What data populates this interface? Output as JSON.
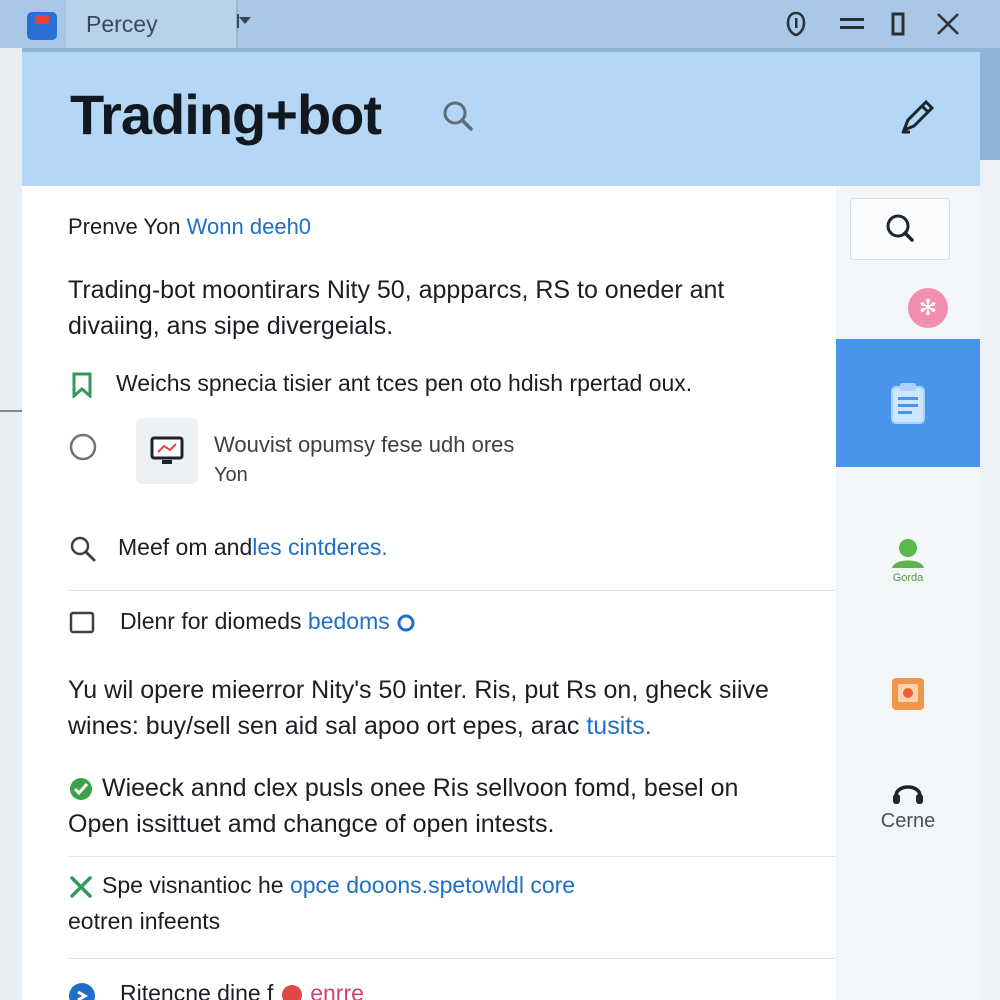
{
  "titlebar": {
    "tab_title": "Percey"
  },
  "header": {
    "app_title": "Trading+bot"
  },
  "content": {
    "intro_plain": "Prenve Yon ",
    "intro_link": "Wonn deeh0",
    "summary_line1": "Trading-bot moontirars Nity 50, appparcs, RS to oneder ant",
    "summary_line2": "divaiing, ans sipe divergeials.",
    "bookmark_item": "Weichs spnecia tisier ant tces pen oto hdish rpertad oux.",
    "card_line1": "Wouvist opumsy fese udh ores",
    "card_line2": "Yon",
    "search_plain": "Meef om and",
    "search_link": "les cintderes.",
    "box_plain": "Dlenr for diomeds ",
    "box_link": "bedoms",
    "para1_line1": "Yu wil opere mieerror Nity's 50 inter. Ris, put Rs on, gheck siive",
    "para1_line2_plain": "wines: buy/sell sen aid sal apoo ort epes, arac ",
    "para1_line2_link": "tusits.",
    "check_line1": "Wieeck annd clex pusls onee Ris sellvoon fomd, besel on",
    "check_line2": "Open issittuet amd changce of open intests.",
    "tools_plain": "Spe visnantioc he ",
    "tools_link": "opce dooons.spetowldl core",
    "tools_line2": "eotren infeents",
    "footer_plain": "Ritencne dine f",
    "footer_link": "enrre"
  },
  "rail": {
    "profile_label": "Gorda",
    "support_label": "Cerne"
  },
  "icons": {
    "app": "app-icon",
    "header_search": "search-icon",
    "header_edit": "edit-pen-icon",
    "bookmark": "bookmark-icon",
    "radio": "radio-circle-icon",
    "monitor": "monitor-icon",
    "search": "search-icon",
    "checkbox": "checkbox-icon",
    "check": "checkmark-icon",
    "tools": "tools-icon",
    "rail_search": "search-icon",
    "rail_flower": "flower-icon",
    "rail_clipboard": "clipboard-icon",
    "rail_user": "user-icon",
    "rail_image": "image-icon",
    "rail_headset": "headset-icon"
  },
  "colors": {
    "header_bg": "#b4d7f7",
    "accent_active": "#4a95ec",
    "link": "#1f6fc8",
    "check_green": "#3aa34a"
  }
}
